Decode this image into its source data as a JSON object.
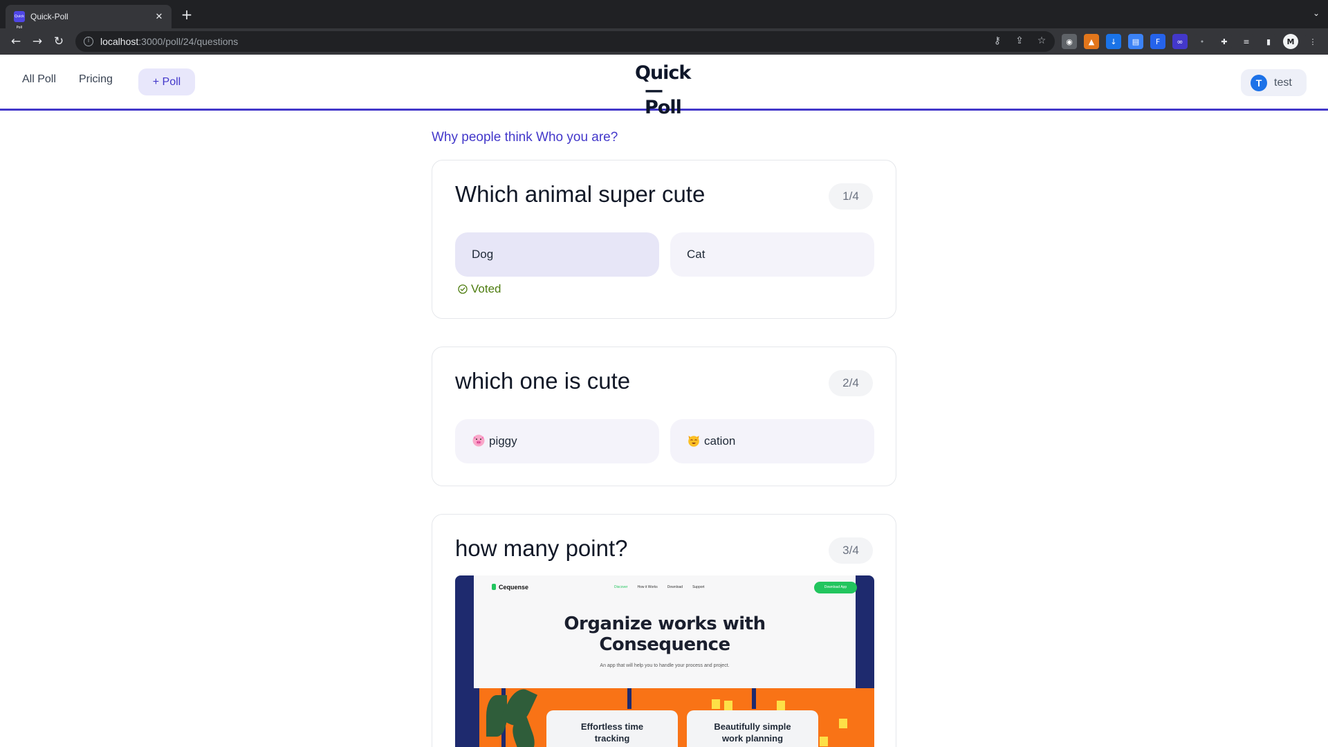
{
  "browser": {
    "tab_title": "Quick-Poll",
    "tab_favicon_text": "Quick Poll",
    "url_host": "localhost",
    "url_path": ":3000/poll/24/questions"
  },
  "header": {
    "nav": [
      {
        "label": "All Poll"
      },
      {
        "label": "Pricing"
      }
    ],
    "new_poll_label": "+ Poll",
    "logo_line1": "Quick",
    "logo_line2": "—Poll",
    "user_initial": "T",
    "user_name": "test"
  },
  "poll": {
    "title": "Why people think Who you are?",
    "questions": [
      {
        "title": "Which animal super cute",
        "badge": "1/4",
        "options": [
          {
            "label": "Dog",
            "selected": true
          },
          {
            "label": "Cat",
            "selected": false
          }
        ],
        "status": "Voted"
      },
      {
        "title": "which one is cute",
        "badge": "2/4",
        "options": [
          {
            "label": "piggy",
            "emoji": "pig-face-icon"
          },
          {
            "label": "cation",
            "emoji": "cat-face-icon"
          }
        ]
      },
      {
        "title": "how many point?",
        "badge": "3/4",
        "image": {
          "logo_text": "Cequense",
          "nav_links": [
            "Discover",
            "How it Works",
            "Download",
            "Support"
          ],
          "button": "Download App",
          "hero_line1": "Organize works with",
          "hero_line2": "Consequence",
          "subtitle": "An app that will help you to handle your process and project.",
          "card1_line1": "Effortless time",
          "card1_line2": "tracking",
          "card2_line1": "Beautifully simple",
          "card2_line2": "work planning"
        }
      }
    ]
  },
  "colors": {
    "accent": "#4338ca",
    "voted": "#4d7c0f",
    "option_bg": "#f4f3fa",
    "option_selected_bg": "#e7e6f7"
  }
}
